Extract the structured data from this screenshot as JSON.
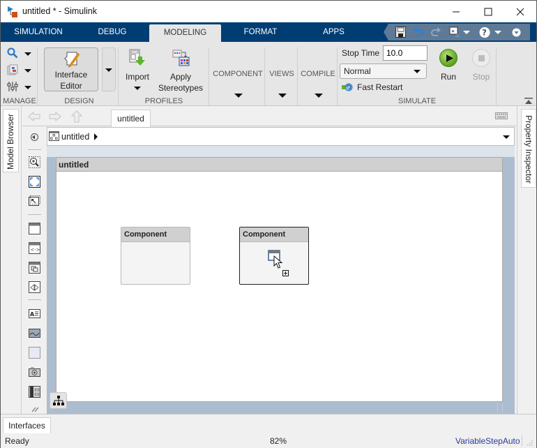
{
  "window": {
    "title": "untitled * - Simulink",
    "controls": {
      "minimize": "minimize-icon",
      "maximize": "maximize-icon",
      "close": "close-icon"
    }
  },
  "ribbon_tabs": [
    {
      "label": "SIMULATION",
      "active": false
    },
    {
      "label": "DEBUG",
      "active": false
    },
    {
      "label": "MODELING",
      "active": true
    },
    {
      "label": "FORMAT",
      "active": false
    },
    {
      "label": "APPS",
      "active": false
    }
  ],
  "quick_access": {
    "icons": [
      "save-icon",
      "undo-icon",
      "redo-icon",
      "shortcuts-icon",
      "help-icon",
      "options-icon"
    ]
  },
  "ribbon": {
    "manage": {
      "label": "MANAGE",
      "icons": [
        "find-icon",
        "model-settings-icon",
        "parameters-icon"
      ]
    },
    "design": {
      "label": "DESIGN",
      "interface_editor": "Interface\nEditor",
      "interface_editor_line1": "Interface",
      "interface_editor_line2": "Editor"
    },
    "profiles": {
      "label": "PROFILES",
      "import": "Import",
      "apply_line1": "Apply",
      "apply_line2": "Stereotypes"
    },
    "component": {
      "label": "COMPONENT"
    },
    "views": {
      "label": "VIEWS"
    },
    "compile": {
      "label": "COMPILE"
    },
    "simulate": {
      "label": "SIMULATE",
      "stop_time_label": "Stop Time",
      "stop_time_value": "10.0",
      "mode": "Normal",
      "fast_restart": "Fast Restart",
      "run": "Run",
      "stop": "Stop"
    }
  },
  "left_dock": {
    "model_browser": "Model Browser"
  },
  "right_dock": {
    "property_inspector": "Property Inspector"
  },
  "editor": {
    "doc_tab": "untitled",
    "address": "untitled",
    "diagram_title": "untitled",
    "components": [
      {
        "label": "Component",
        "selected": false
      },
      {
        "label": "Component",
        "selected": true
      }
    ]
  },
  "palette": {
    "icons": [
      "zoom-in-icon",
      "fit-to-view-icon",
      "zoom-100-icon",
      "component-icon",
      "reference-component-icon",
      "variant-component-icon",
      "adapter-icon",
      "annotation-icon",
      "image-icon",
      "area-icon",
      "screenshot-icon",
      "requirements-icon"
    ]
  },
  "bottom": {
    "interfaces_tab": "Interfaces"
  },
  "status": {
    "ready": "Ready",
    "zoom": "82%",
    "solver": "VariableStepAuto"
  },
  "colors": {
    "tabbar": "#003d73",
    "qat": "#5e7a96",
    "ribbon": "#e6e6e6",
    "canvas_frame": "#adbdd0",
    "solver_link": "#2a3a9a"
  }
}
